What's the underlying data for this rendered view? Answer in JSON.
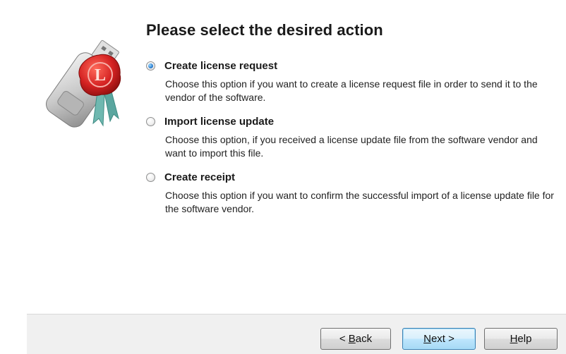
{
  "heading": "Please select the desired action",
  "options": [
    {
      "label": "Create license request",
      "selected": true,
      "description": "Choose this option if you want to create a license request file in order to send it to the vendor of the software."
    },
    {
      "label": "Import license update",
      "selected": false,
      "description": "Choose this option, if you received a license update file from the software vendor and want to import this file."
    },
    {
      "label": "Create receipt",
      "selected": false,
      "description": "Choose this option if you want to confirm the successful import of a license update file for the software vendor."
    }
  ],
  "buttons": {
    "back": {
      "prefix": "< ",
      "mnemonic": "B",
      "rest": "ack"
    },
    "next": {
      "mnemonic": "N",
      "rest": "ext >"
    },
    "help": {
      "mnemonic": "H",
      "rest": "elp"
    }
  },
  "logo": {
    "icon": "usb-license-key-icon",
    "seal_letter": "L"
  },
  "colors": {
    "seal_red": "#c81e1e",
    "radio_dot": "#2e7fd0",
    "default_button_border": "#3c7fb1"
  }
}
